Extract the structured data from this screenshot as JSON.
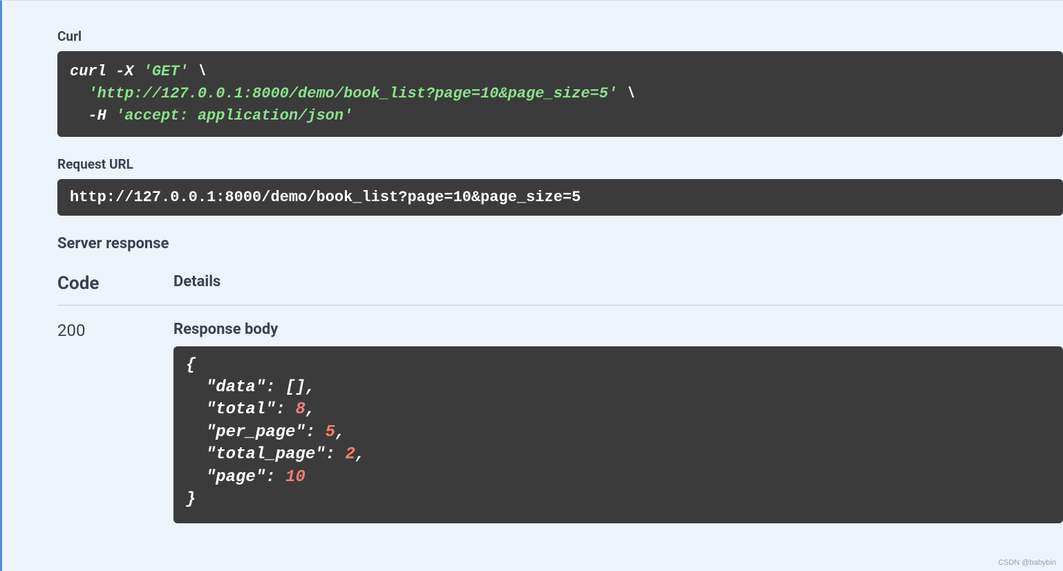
{
  "curl": {
    "label": "Curl",
    "line1_prefix": "curl -X ",
    "line1_method": "'GET'",
    "line1_suffix": " \\",
    "line2_indent": "  ",
    "line2_url": "'http://127.0.0.1:8000/demo/book_list?page=10&page_size=5'",
    "line2_suffix": " \\",
    "line3_indent": "  ",
    "line3_flag": "-H ",
    "line3_header": "'accept: application/json'"
  },
  "request_url": {
    "label": "Request URL",
    "value": "http://127.0.0.1:8000/demo/book_list?page=10&page_size=5"
  },
  "server_response": {
    "label": "Server response",
    "code_header": "Code",
    "details_header": "Details",
    "status_code": "200",
    "response_body_label": "Response body",
    "json": {
      "open": "{",
      "l1_key": "\"data\"",
      "l1_colon": ": ",
      "l1_val": "[]",
      "l1_comma": ",",
      "l2_key": "\"total\"",
      "l2_colon": ": ",
      "l2_val": "8",
      "l2_comma": ",",
      "l3_key": "\"per_page\"",
      "l3_colon": ": ",
      "l3_val": "5",
      "l3_comma": ",",
      "l4_key": "\"total_page\"",
      "l4_colon": ": ",
      "l4_val": "2",
      "l4_comma": ",",
      "l5_key": "\"page\"",
      "l5_colon": ": ",
      "l5_val": "10",
      "close": "}"
    }
  },
  "watermark": "CSDN @babybin"
}
